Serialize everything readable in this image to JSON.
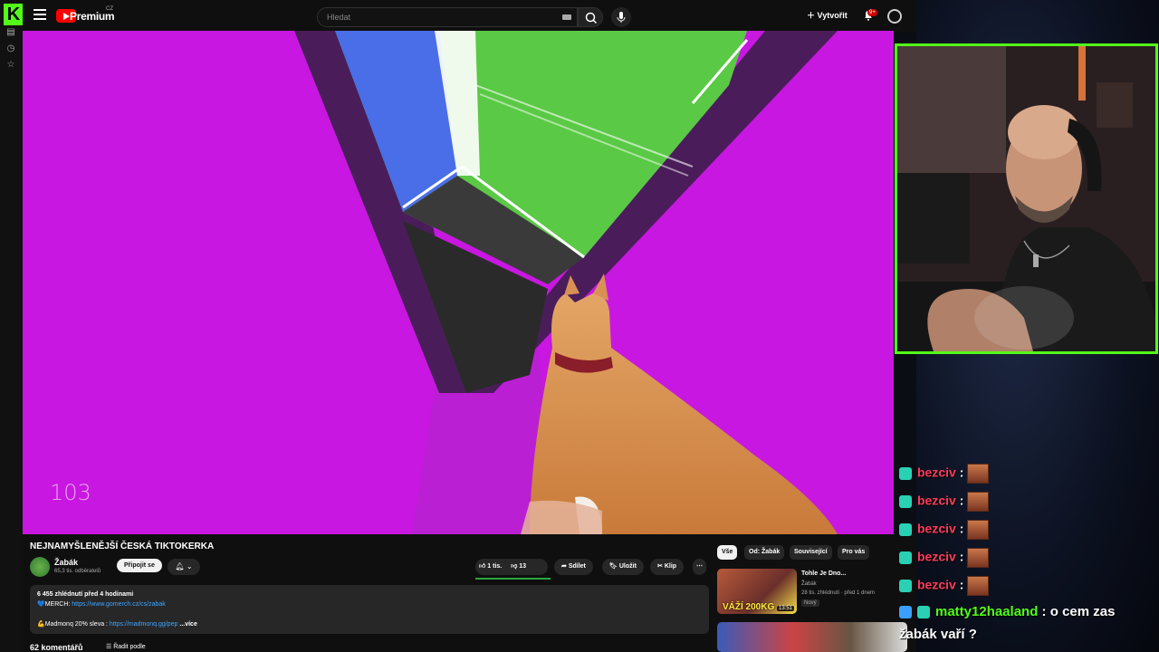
{
  "youtube": {
    "brand": "Premium",
    "country": "CZ",
    "search_placeholder": "Hledat",
    "create_label": "Vytvořit",
    "notif_count": "9+",
    "video": {
      "counter": "103",
      "title": "NEJNAMYŠLENĚJŠÍ ČESKÁ TIKTOKERKA",
      "channel": "Žabák",
      "subscribers": "65,3 tis. odběratelů",
      "join_label": "Připojit se",
      "likes": "1 tis.",
      "dislikes": "13",
      "share_label": "Sdílet",
      "save_label": "Uložit",
      "clip_label": "Klip",
      "description": {
        "meta": "6 455 zhlédnutí  před 4 hodinami",
        "merch_label": "💙MERCH: ",
        "merch_link": "https://www.gomerch.cz/cs/zabak",
        "madmonq_label": "💪Madmonq 20% sleva : ",
        "madmonq_link": "https://madmonq.gg/pep",
        "more": "...více"
      },
      "comments_count": "62 komentářů",
      "sort_label": "Řadit podle"
    },
    "chips": [
      "Vše",
      "Od: Žabák",
      "Související",
      "Pro vás"
    ],
    "recommendations": [
      {
        "title": "Tohle Je Dno...",
        "channel": "Žabák",
        "meta": "28 tis. zhlédnutí · před 1 dnem",
        "badge": "Nový",
        "thumb_text": "VÁŽÍ 200KG",
        "duration": "13:51"
      }
    ]
  },
  "chat": [
    {
      "user": "bezciv",
      "text": "",
      "emote": true
    },
    {
      "user": "bezciv",
      "text": "",
      "emote": true
    },
    {
      "user": "bezciv",
      "text": "",
      "emote": true
    },
    {
      "user": "bezciv",
      "text": "",
      "emote": true
    },
    {
      "user": "bezciv",
      "text": "",
      "emote": true
    },
    {
      "user": "matty12haaland",
      "text": "o cem zas",
      "emote": false
    },
    {
      "user": "",
      "text": "žabák vaří ?",
      "emote": false
    }
  ],
  "colors": {
    "kick_green": "#53fc18",
    "video_magenta": "#c817e0",
    "chat_red": "#ff3b5c",
    "yt_red": "#ff0000"
  }
}
